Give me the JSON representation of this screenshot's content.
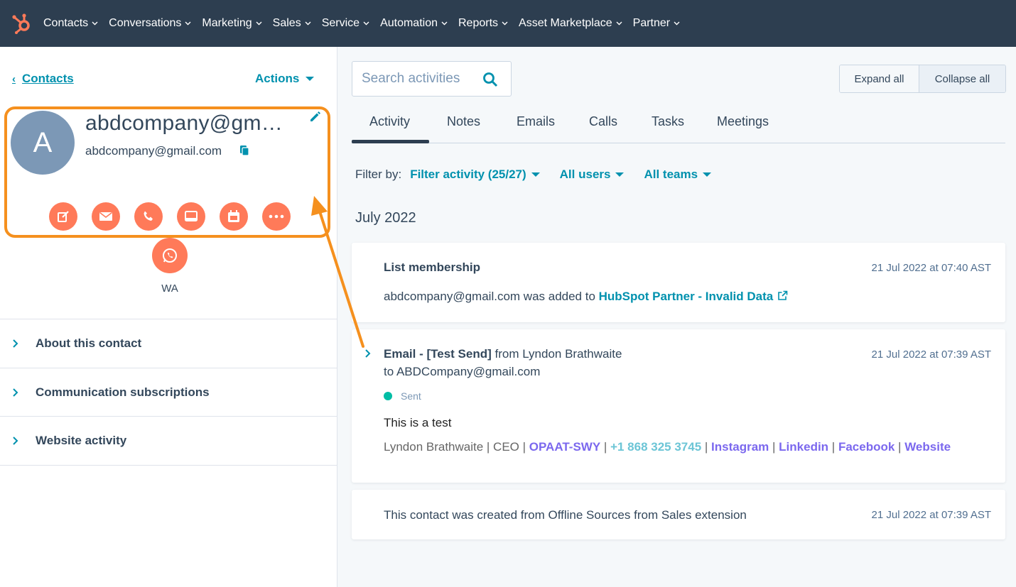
{
  "nav": {
    "items": [
      "Contacts",
      "Conversations",
      "Marketing",
      "Sales",
      "Service",
      "Automation",
      "Reports",
      "Asset Marketplace",
      "Partner"
    ]
  },
  "contact": {
    "back_label": "Contacts",
    "actions_label": "Actions",
    "avatar_initial": "A",
    "name": "abdcompany@gm…",
    "email": "abdcompany@gmail.com",
    "wa_label": "WA"
  },
  "sections": [
    "About this contact",
    "Communication subscriptions",
    "Website activity"
  ],
  "search": {
    "placeholder": "Search activities"
  },
  "toolbar": {
    "expand_all": "Expand all",
    "collapse_all": "Collapse all"
  },
  "tabs": [
    "Activity",
    "Notes",
    "Emails",
    "Calls",
    "Tasks",
    "Meetings"
  ],
  "filters": {
    "label": "Filter by:",
    "activity": "Filter activity (25/27)",
    "users": "All users",
    "teams": "All teams"
  },
  "timeline": {
    "month": "July 2022",
    "list_membership": {
      "title": "List membership",
      "timestamp": "21 Jul 2022 at 07:40 AST",
      "text": "abdcompany@gmail.com was added to ",
      "list_name": "HubSpot Partner - Invalid Data"
    },
    "email": {
      "title": "Email - [Test Send]",
      "from_text": " from Lyndon Brathwaite",
      "to_text": "to ABDCompany@gmail.com",
      "timestamp": "21 Jul 2022 at 07:39 AST",
      "status": "Sent",
      "body": "This is a test",
      "sig_name": "Lyndon Brathwaite | CEO | ",
      "sig_company": "OPAAT-SWY",
      "sig_sep": " | ",
      "sig_phone": "+1 868 325 3745",
      "sig_instagram": "Instagram",
      "sig_linkedin": "Linkedin",
      "sig_facebook": "Facebook",
      "sig_website": "Website"
    },
    "created": {
      "text": "This contact was created from Offline Sources from Sales extension",
      "timestamp": "21 Jul 2022 at 07:39 AST"
    }
  },
  "colors": {
    "nav_bg": "#2d3e50",
    "accent": "#0091ae",
    "action_orange": "#ff7a59",
    "highlight_orange": "#f5901e",
    "status_green": "#00bda5"
  },
  "icons": {
    "logo": "hubspot-sprocket-icon",
    "copy": "copy-icon",
    "edit": "pencil-icon",
    "search": "search-icon",
    "external_link": "external-link-icon",
    "actions": [
      "note-icon",
      "email-icon",
      "phone-icon",
      "task-icon",
      "meeting-icon",
      "more-icon",
      "whatsapp-icon"
    ]
  }
}
